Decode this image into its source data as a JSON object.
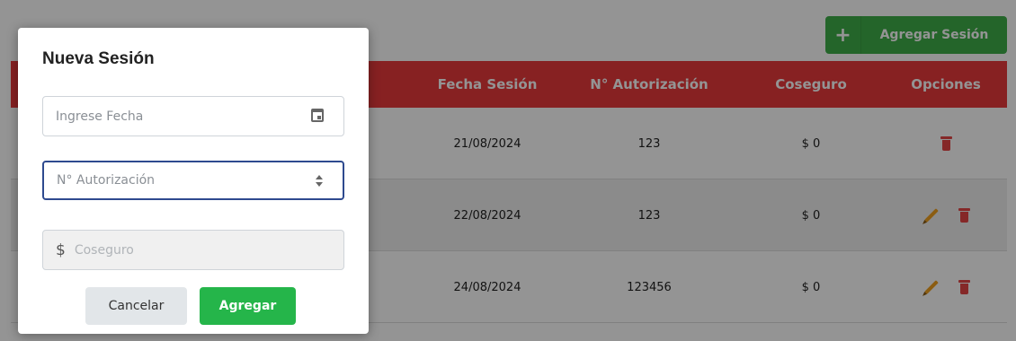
{
  "header": {
    "add_session_label": "Agregar Sesión",
    "add_icon": "plus-icon"
  },
  "table": {
    "columns": [
      "Fecha Sesión",
      "N° Autorización",
      "Coseguro",
      "Opciones"
    ],
    "rows": [
      {
        "fecha": "21/08/2024",
        "autorizacion": "123",
        "coseguro": "$ 0",
        "actions": [
          "trash-icon"
        ]
      },
      {
        "fecha": "22/08/2024",
        "autorizacion": "123",
        "coseguro": "$ 0",
        "actions": [
          "pencil-icon",
          "trash-icon"
        ]
      },
      {
        "fecha": "24/08/2024",
        "autorizacion": "123456",
        "coseguro": "$ 0",
        "actions": [
          "pencil-icon",
          "trash-icon"
        ]
      }
    ],
    "header_color": "#e9393c"
  },
  "modal": {
    "title": "Nueva Sesión",
    "fecha_placeholder": "Ingrese Fecha",
    "autorizacion_placeholder": "N° Autorización",
    "coseguro_symbol": "$",
    "coseguro_placeholder": "Coseguro",
    "cancel_label": "Cancelar",
    "submit_label": "Agregar"
  }
}
